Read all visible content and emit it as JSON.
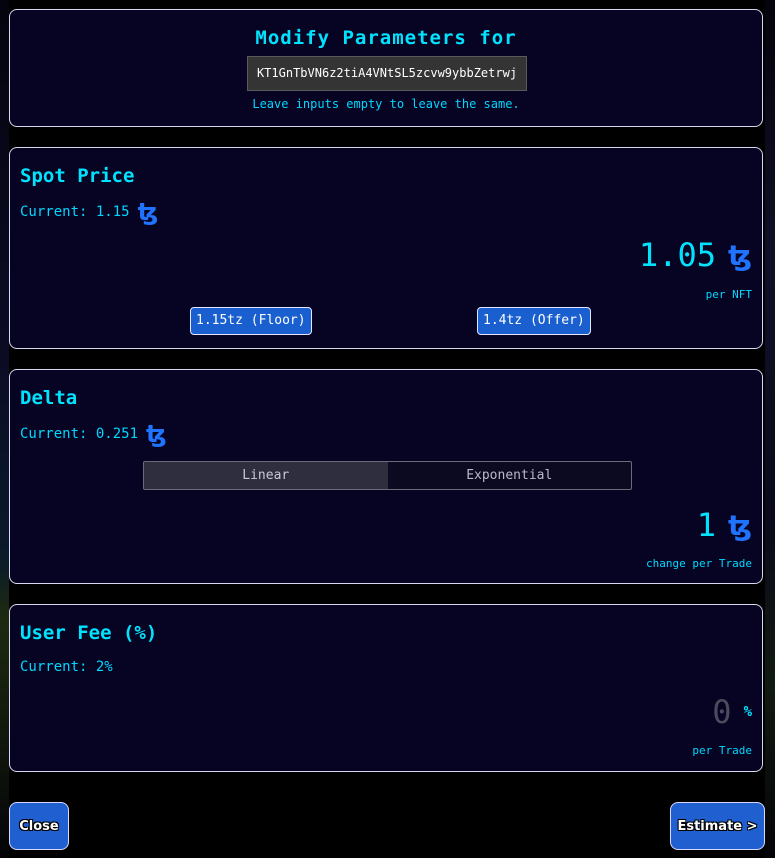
{
  "header": {
    "title": "Modify Parameters for",
    "address": "KT1GnTbVN6z2tiA4VNtSL5zcvw9ybbZetrwj",
    "hint": "Leave inputs empty to leave the same."
  },
  "spot_price": {
    "title": "Spot Price",
    "current": "Current: 1.15",
    "value": "1.05",
    "unit_label": "per NFT",
    "presets": [
      "1.15tz (Floor)",
      "1.4tz (Offer)"
    ]
  },
  "delta": {
    "title": "Delta",
    "current": "Current: 0.251",
    "modes": [
      "Linear",
      "Exponential"
    ],
    "selected_mode": "Linear",
    "value": "1",
    "unit_label": "change per Trade"
  },
  "user_fee": {
    "title": "User Fee (%)",
    "current": "Current: 2%",
    "placeholder": "0",
    "percent_symbol": "%",
    "unit_label": "per Trade"
  },
  "footer": {
    "close_label": "Close",
    "estimate_label": "Estimate >"
  },
  "icons": {
    "currency": "tez-icon",
    "currency_glyph": "ꜩ"
  },
  "colors": {
    "accent_text": "#00e3ff",
    "panel_bg": "#070322",
    "button_bg": "#1f5fd0",
    "tez_icon": "#1f73ff"
  }
}
